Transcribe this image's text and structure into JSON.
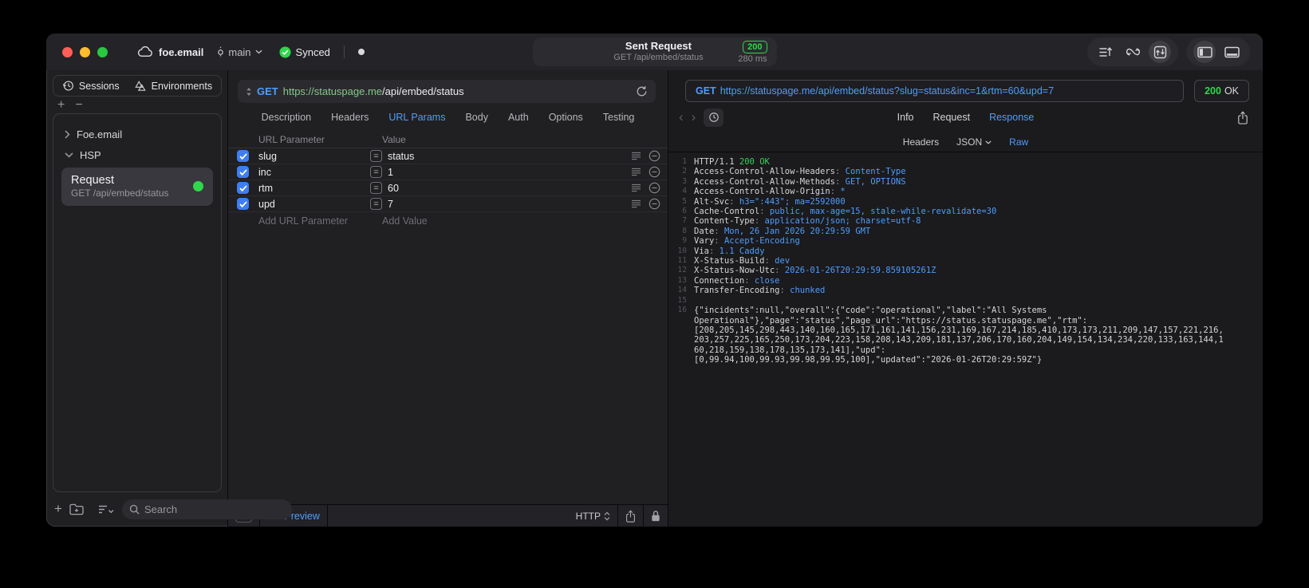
{
  "colors": {
    "accent": "#4d9eff",
    "success": "#30d74b",
    "host_green": "#85c78b",
    "checkbox_blue": "#3d7df5",
    "badge_green": "#30d74b"
  },
  "titlebar": {
    "project": "foe.email",
    "branch": "main",
    "sync": "Synced",
    "title": "Sent Request",
    "subtitle": "GET /api/embed/status",
    "status_code": "200",
    "duration": "280 ms"
  },
  "sidebar": {
    "tabs": [
      {
        "label": "Sessions"
      },
      {
        "label": "Environments"
      }
    ],
    "tree": {
      "group_collapsed": "Foe.email",
      "group_expanded": "HSP"
    },
    "request_item": {
      "title": "Request",
      "subtitle": "GET /api/embed/status"
    },
    "search_placeholder": "Search"
  },
  "editor": {
    "method": "GET",
    "url_host": "https://statuspage.me",
    "url_path": "/api/embed/status",
    "tabs": [
      "Description",
      "Headers",
      "URL Params",
      "Body",
      "Auth",
      "Options",
      "Testing"
    ],
    "active_tab": "URL Params",
    "table": {
      "col_name": "URL Parameter",
      "col_value": "Value",
      "rows": [
        {
          "name": "slug",
          "value": "status",
          "checked": true
        },
        {
          "name": "inc",
          "value": "1",
          "checked": true
        },
        {
          "name": "rtm",
          "value": "60",
          "checked": true
        },
        {
          "name": "upd",
          "value": "7",
          "checked": true
        }
      ],
      "add_name": "Add URL Parameter",
      "add_value": "Add Value"
    },
    "footer": {
      "preview": "Preview",
      "code_glyph": "</>",
      "protocol": "HTTP"
    }
  },
  "response": {
    "request_method": "GET",
    "request_url": "https://statuspage.me/api/embed/status?slug=status&inc=1&rtm=60&upd=7",
    "status_code": "200",
    "status_text": "OK",
    "tabs": [
      {
        "label": "Info"
      },
      {
        "label": "Request"
      },
      {
        "label": "Response",
        "active": true
      }
    ],
    "view_tabs": [
      {
        "label": "Headers"
      },
      {
        "label": "JSON",
        "dropdown": true
      },
      {
        "label": "Raw",
        "active": true
      }
    ],
    "status_line": {
      "protocol": "HTTP/1.1",
      "status": "200 OK"
    },
    "headers": [
      {
        "name": "Access-Control-Allow-Headers",
        "value": "Content-Type"
      },
      {
        "name": "Access-Control-Allow-Methods",
        "value": "GET, OPTIONS"
      },
      {
        "name": "Access-Control-Allow-Origin",
        "value": "*"
      },
      {
        "name": "Alt-Svc",
        "value": "h3=\":443\"; ma=2592000"
      },
      {
        "name": "Cache-Control",
        "value": "public, max-age=15, stale-while-revalidate=30"
      },
      {
        "name": "Content-Type",
        "value": "application/json; charset=utf-8"
      },
      {
        "name": "Date",
        "value": "Mon, 26 Jan 2026 20:29:59 GMT"
      },
      {
        "name": "Vary",
        "value": "Accept-Encoding"
      },
      {
        "name": "Via",
        "value": "1.1 Caddy"
      },
      {
        "name": "X-Status-Build",
        "value": "dev"
      },
      {
        "name": "X-Status-Now-Utc",
        "value": "2026-01-26T20:29:59.859105261Z"
      },
      {
        "name": "Connection",
        "value": "close"
      },
      {
        "name": "Transfer-Encoding",
        "value": "chunked"
      }
    ],
    "body_lines": [
      "{\"incidents\":null,\"overall\":{\"code\":\"operational\",\"label\":\"All Systems",
      "Operational\"},\"page\":\"status\",\"page_url\":\"https://status.statuspage.me\",\"rtm\":",
      "[208,205,145,298,443,140,160,165,171,161,141,156,231,169,167,214,185,410,173,173,211,209,147,157,221,216,",
      "203,257,225,165,250,173,204,223,158,208,143,209,181,137,206,170,160,204,149,154,134,234,220,133,163,144,1",
      "60,218,159,138,178,135,173,141],\"upd\":",
      "[0,99.94,100,99.93,99.98,99.95,100],\"updated\":\"2026-01-26T20:29:59Z\"}"
    ]
  }
}
